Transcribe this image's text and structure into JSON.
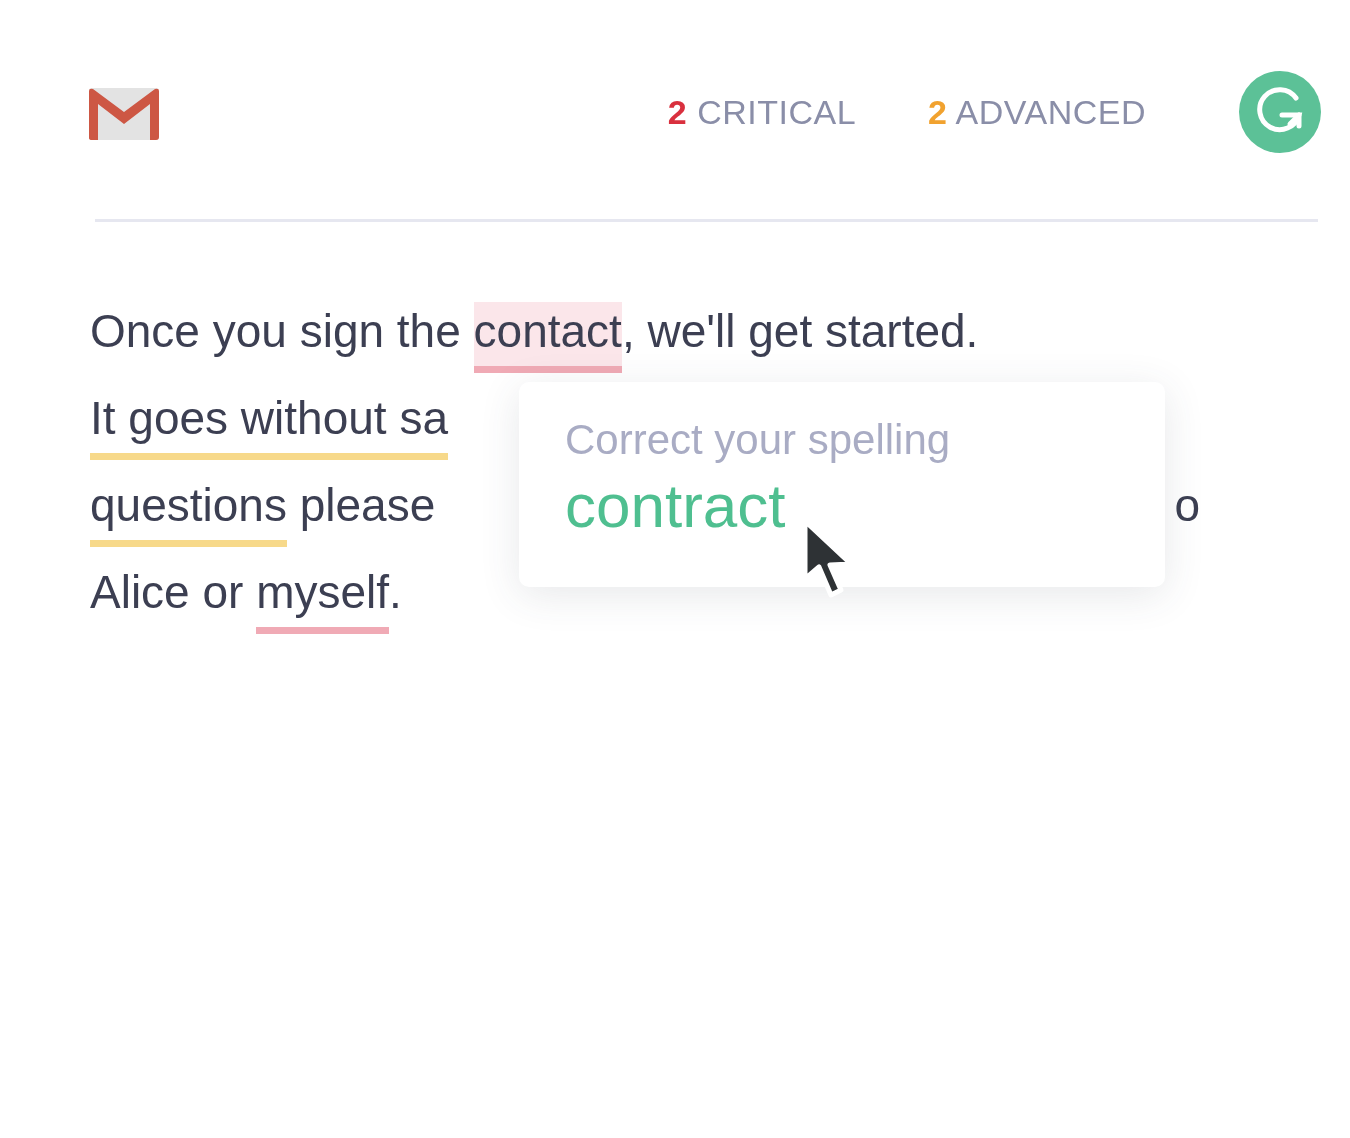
{
  "header": {
    "counters": [
      {
        "count": "2",
        "label": "CRITICAL",
        "color": "#d9303e"
      },
      {
        "count": "2",
        "label": "ADVANCED",
        "color": "#f1a22f"
      }
    ]
  },
  "lines": [
    {
      "segments": [
        {
          "text": "Once you sign the ",
          "kind": "plain"
        },
        {
          "text": "contact",
          "kind": "critical",
          "selected": true
        },
        {
          "text": ", we'll get started.",
          "kind": "plain"
        }
      ]
    },
    {
      "segments": [
        {
          "text": "It goes without sa",
          "kind": "advanced",
          "selected": false
        }
      ]
    },
    {
      "segments": [
        {
          "text": "questions",
          "kind": "advanced",
          "selected": false
        },
        {
          "text": " please",
          "kind": "plain"
        }
      ],
      "tail": "o"
    },
    {
      "segments": [
        {
          "text": "Alice or ",
          "kind": "plain"
        },
        {
          "text": "myself",
          "kind": "critical",
          "selected": false
        },
        {
          "text": ".",
          "kind": "plain"
        }
      ]
    }
  ],
  "popup": {
    "title": "Correct your spelling",
    "suggestion": "contract"
  }
}
